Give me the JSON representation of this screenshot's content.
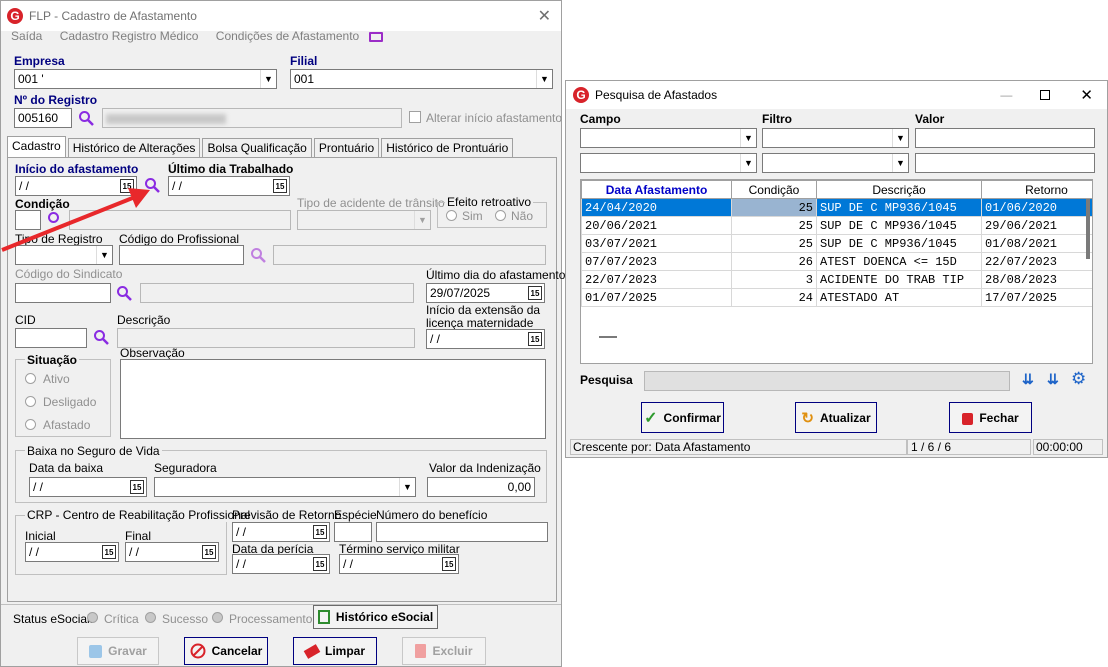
{
  "win1": {
    "title": "FLP - Cadastro de Afastamento",
    "menu": [
      "Saída",
      "Cadastro Registro Médico",
      "Condições de Afastamento"
    ],
    "empresa_label": "Empresa",
    "empresa_value": "001 '",
    "filial_label": "Filial",
    "filial_value": "001",
    "registro_label": "Nº do Registro",
    "registro_value": "005160",
    "alterar_label": "Alterar início afastamento",
    "tabs": [
      "Cadastro",
      "Histórico de Alterações",
      "Bolsa Qualificação",
      "Prontuário",
      "Histórico de Prontuário"
    ],
    "inicio_label": "Início do afastamento",
    "inicio_value": " / /",
    "ultimo_label": "Último dia Trabalhado",
    "ultimo_value": " / /",
    "condicao_label": "Condição",
    "tipo_acidente_label": "Tipo de acidente de trânsito",
    "efeito_label": "Efeito retroativo",
    "sim_label": "Sim",
    "nao_label": "Não",
    "tipo_registro_label": "Tipo de Registro",
    "codigo_prof_label": "Código do Profissional",
    "codigo_sind_label": "Código do Sindicato",
    "ultimo_afast_label": "Último dia do afastamento",
    "ultimo_afast_value": "29/07/2025",
    "cid_label": "CID",
    "descricao_label": "Descrição",
    "inicio_ext_label1": "Início da extensão da",
    "inicio_ext_label2": "licença maternidade",
    "inicio_ext_value": " / /",
    "situacao_label": "Situação",
    "ativo_label": "Ativo",
    "desligado_label": "Desligado",
    "afastado_label": "Afastado",
    "observacao_label": "Observação",
    "baixa_label": "Baixa no Seguro de Vida",
    "data_baixa_label": "Data da baixa",
    "data_baixa_value": " / /",
    "seguradora_label": "Seguradora",
    "valor_ind_label": "Valor da Indenização",
    "valor_ind_value": "0,00",
    "crp_label": "CRP - Centro de Reabilitação Profissional",
    "inicial_label": "Inicial",
    "inicial_value": " / /",
    "final_label": "Final",
    "final_value": " / /",
    "prev_retorno_label": "Previsão de Retorno",
    "prev_retorno_value": " / /",
    "especie_label": "Espécie",
    "num_beneficio_label": "Número do benefício",
    "data_pericia_label": "Data da perícia",
    "data_pericia_value": " / /",
    "termino_label": "Término serviço militar",
    "termino_value": " / /",
    "status_esocial_label": "Status eSocial:",
    "critica_label": "Crítica",
    "sucesso_label": "Sucesso",
    "processamento_label": "Processamento",
    "historico_esocial_label": "Histórico eSocial",
    "gravar_label": "Gravar",
    "cancelar_label": "Cancelar",
    "limpar_label": "Limpar",
    "excluir_label": "Excluir"
  },
  "win2": {
    "title": "Pesquisa de Afastados",
    "campo_label": "Campo",
    "filtro_label": "Filtro",
    "valor_label": "Valor",
    "columns": [
      "Data Afastamento",
      "Condição",
      "Descrição",
      "Retorno"
    ],
    "rows": [
      [
        "24/04/2020",
        "25",
        "SUP DE C MP936/1045",
        "01/06/2020"
      ],
      [
        "20/06/2021",
        "25",
        "SUP DE C MP936/1045",
        "29/06/2021"
      ],
      [
        "03/07/2021",
        "25",
        "SUP DE C MP936/1045",
        "01/08/2021"
      ],
      [
        "07/07/2023",
        "26",
        "ATEST DOENCA <= 15D",
        "22/07/2023"
      ],
      [
        "22/07/2023",
        "3",
        "ACIDENTE DO TRAB TIP",
        "28/08/2023"
      ],
      [
        "01/07/2025",
        "24",
        "ATESTADO AT",
        "17/07/2025"
      ]
    ],
    "pesquisa_label": "Pesquisa",
    "confirmar_label": "Confirmar",
    "atualizar_label": "Atualizar",
    "fechar_label": "Fechar",
    "status_sort": "Crescente por: Data Afastamento",
    "status_count": "1 / 6 / 6",
    "status_time": "00:00:00"
  },
  "colors": {
    "accent": "#000080",
    "selection": "#0078d7",
    "logo": "#d8232a",
    "arrow": "#e8282b"
  }
}
